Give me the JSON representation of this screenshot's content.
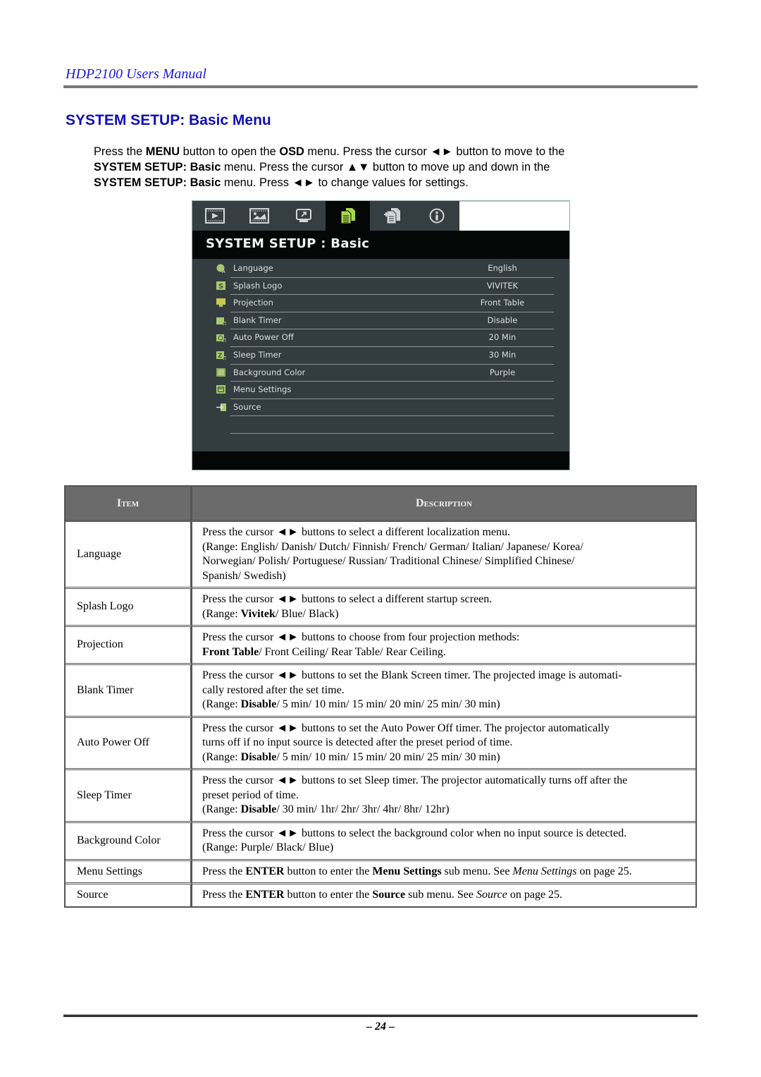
{
  "header": {
    "manual_title": "HDP2100 Users Manual"
  },
  "section": {
    "title": "SYSTEM SETUP: Basic Menu"
  },
  "intro": {
    "line1": [
      {
        "t": "Press the ",
        "b": false
      },
      {
        "t": "MENU",
        "b": true
      },
      {
        "t": " button to open the ",
        "b": false
      },
      {
        "t": "OSD",
        "b": true
      },
      {
        "t": " menu. Press the cursor ◄► button to move to the",
        "b": false
      }
    ],
    "line2": [
      {
        "t": "SYSTEM SETUP: Basic",
        "b": true
      },
      {
        "t": " menu. Press the cursor ▲▼ button to move up and down in the",
        "b": false
      }
    ],
    "line3": [
      {
        "t": "SYSTEM SETUP: Basic",
        "b": true
      },
      {
        "t": " menu. Press ◄► to change values for settings.",
        "b": false
      }
    ]
  },
  "osd": {
    "tabs": [
      {
        "icon": "film-play-icon",
        "active": false
      },
      {
        "icon": "film-image-icon",
        "active": false
      },
      {
        "icon": "monitor-arrow-icon",
        "active": false
      },
      {
        "icon": "documents-icon",
        "active": true
      },
      {
        "icon": "documents-plus-icon",
        "active": false
      },
      {
        "icon": "info-icon",
        "active": false
      }
    ],
    "title": "SYSTEM SETUP : Basic",
    "items": [
      {
        "label": "Language",
        "value": "English",
        "icon": "globe-language-icon"
      },
      {
        "label": "Splash Logo",
        "value": "VIVITEK",
        "icon": "splash-s-icon"
      },
      {
        "label": "Projection",
        "value": "Front Table",
        "icon": "projection-screen-icon"
      },
      {
        "label": "Blank Timer",
        "value": "Disable",
        "icon": "blank-timer-icon"
      },
      {
        "label": "Auto Power Off",
        "value": "20 Min",
        "icon": "auto-power-off-icon"
      },
      {
        "label": "Sleep Timer",
        "value": "30 Min",
        "icon": "sleep-timer-icon"
      },
      {
        "label": "Background Color",
        "value": "Purple",
        "icon": "background-color-icon"
      },
      {
        "label": "Menu Settings",
        "value": "",
        "icon": "menu-settings-icon"
      },
      {
        "label": "Source",
        "value": "",
        "icon": "source-arrow-icon"
      }
    ]
  },
  "table": {
    "headers": {
      "item": "Item",
      "description": "Description"
    },
    "rows": [
      {
        "item": "Language",
        "desc": [
          [
            {
              "t": "Press the cursor ◄► buttons to select a different localization menu."
            }
          ],
          [
            {
              "t": "(Range: English/ Danish/ Dutch/  Finnish/ French/ German/ Italian/ Japanese/ Korea/"
            }
          ],
          [
            {
              "t": "Norwegian/ Polish/ Portuguese/ Russian/ Traditional Chinese/ Simplified Chinese/"
            }
          ],
          [
            {
              "t": "Spanish/ Swedish)"
            }
          ]
        ]
      },
      {
        "item": "Splash Logo",
        "desc": [
          [
            {
              "t": "Press the cursor ◄► buttons to select a different startup screen."
            }
          ],
          [
            {
              "t": "(Range: "
            },
            {
              "t": "Vivitek",
              "s": "b"
            },
            {
              "t": "/ Blue/ Black)"
            }
          ]
        ]
      },
      {
        "item": "Projection",
        "desc": [
          [
            {
              "t": "Press the cursor ◄► buttons to choose from four projection methods:"
            }
          ],
          [
            {
              "t": "Front Table",
              "s": "b"
            },
            {
              "t": "/ Front Ceiling/ Rear Table/ Rear Ceiling."
            }
          ]
        ]
      },
      {
        "item": "Blank Timer",
        "desc": [
          [
            {
              "t": "Press the cursor ◄► buttons to set the Blank Screen timer. The projected image is automati-"
            }
          ],
          [
            {
              "t": "cally restored after the set time."
            }
          ],
          [
            {
              "t": "(Range: "
            },
            {
              "t": "Disable",
              "s": "b"
            },
            {
              "t": "/ 5 min/ 10 min/ 15 min/ 20 min/ 25 min/ 30 min)"
            }
          ]
        ]
      },
      {
        "item": "Auto Power Off",
        "desc": [
          [
            {
              "t": "Press the cursor ◄► buttons to set the Auto Power Off timer. The projector automatically"
            }
          ],
          [
            {
              "t": "turns off if no input source is detected after the preset period of time."
            }
          ],
          [
            {
              "t": "(Range: "
            },
            {
              "t": "Disable",
              "s": "b"
            },
            {
              "t": "/ 5 min/ 10 min/ 15 min/ 20 min/ 25 min/ 30 min)"
            }
          ]
        ]
      },
      {
        "item": "Sleep Timer",
        "desc": [
          [
            {
              "t": "Press the cursor ◄► buttons to set Sleep timer. The projector automatically turns off after the"
            }
          ],
          [
            {
              "t": "preset period of time."
            }
          ],
          [
            {
              "t": "(Range: "
            },
            {
              "t": "Disable",
              "s": "b"
            },
            {
              "t": "/ 30 min/ 1hr/ 2hr/ 3hr/ 4hr/ 8hr/ 12hr)"
            }
          ]
        ]
      },
      {
        "item": "Background Color",
        "desc": [
          [
            {
              "t": "Press the cursor ◄► buttons to select the background color when no input source is detected."
            }
          ],
          [
            {
              "t": "(Range: Purple/ Black/ Blue)"
            }
          ]
        ]
      },
      {
        "item": "Menu Settings",
        "desc": [
          [
            {
              "t": "Press the "
            },
            {
              "t": "ENTER",
              "s": "b"
            },
            {
              "t": " button to enter the "
            },
            {
              "t": "Menu Settings",
              "s": "b"
            },
            {
              "t": " sub menu. See "
            },
            {
              "t": "Menu Settings",
              "s": "i"
            },
            {
              "t": " on page 25."
            }
          ]
        ]
      },
      {
        "item": "Source",
        "desc": [
          [
            {
              "t": "Press the "
            },
            {
              "t": "ENTER",
              "s": "b"
            },
            {
              "t": " button to enter the "
            },
            {
              "t": "Source",
              "s": "b"
            },
            {
              "t": " sub menu. See "
            },
            {
              "t": "Source",
              "s": "i"
            },
            {
              "t": " on page 25."
            }
          ]
        ]
      }
    ]
  },
  "footer": {
    "page_number": "– 24 –"
  },
  "colors": {
    "header_blue": "#1a1ad8",
    "title_blue": "#1010b8",
    "osd_bg": "#333d3f",
    "osd_active_icon": "#a8d84a",
    "table_header_bg": "#6b6b6b"
  }
}
